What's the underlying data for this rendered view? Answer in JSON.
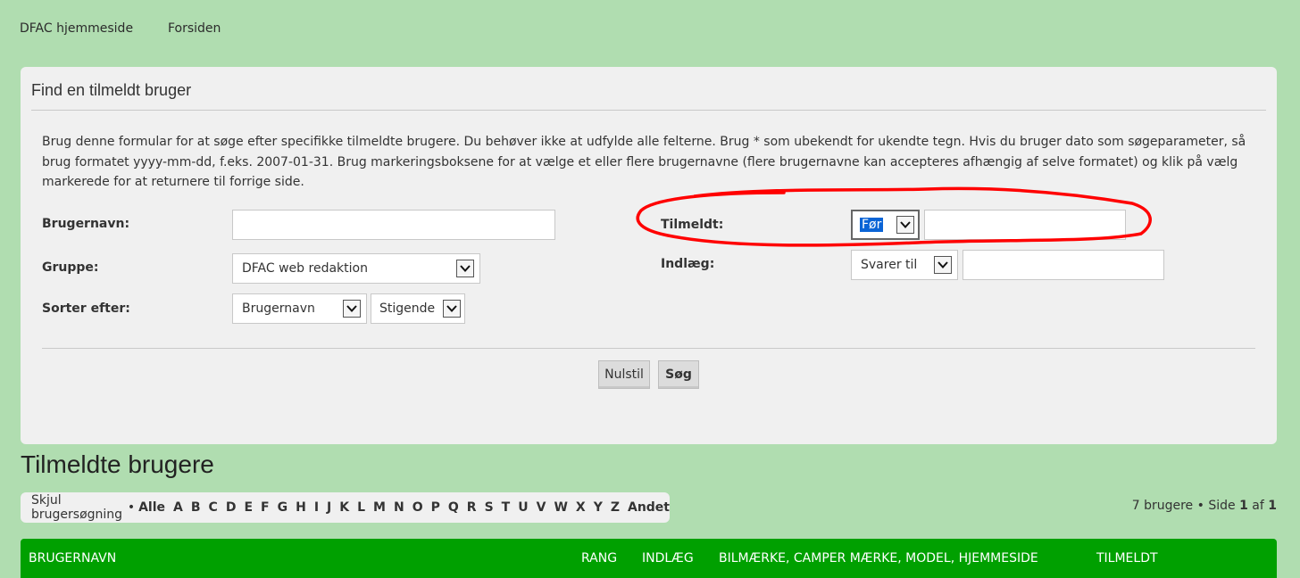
{
  "breadcrumb": {
    "home": "DFAC hjemmeside",
    "forum": "Forsiden"
  },
  "search_panel": {
    "title": "Find en tilmeldt bruger",
    "intro": "Brug denne formular for at søge efter specifikke tilmeldte brugere. Du behøver ikke at udfylde alle felterne. Brug * som ubekendt for ukendte tegn. Hvis du bruger dato som søgeparameter, så brug formatet yyyy-mm-dd, f.eks. 2007-01-31. Brug markeringsboksene for at vælge et eller flere brugernavne (flere brugernavne kan accepteres afhængig af selve formatet) og klik på vælg markerede for at returnere til forrige side.",
    "username_label": "Brugernavn:",
    "username_value": "",
    "group_label": "Gruppe:",
    "group_value": "DFAC web redaktion",
    "sort_label": "Sorter efter:",
    "sort_field_value": "Brugernavn",
    "sort_order_value": "Stigende",
    "joined_label": "Tilmeldt:",
    "joined_mode_value": "Før",
    "joined_date_value": "",
    "posts_label": "Indlæg:",
    "posts_mode_value": "Svarer til",
    "posts_value": "",
    "reset_label": "Nulstil",
    "search_label": "Søg"
  },
  "page_heading": "Tilmeldte brugere",
  "alpha_bar": {
    "hide_label": "Skjul brugersøgning",
    "bullet": "•",
    "letters": [
      "Alle",
      "A",
      "B",
      "C",
      "D",
      "E",
      "F",
      "G",
      "H",
      "I",
      "J",
      "K",
      "L",
      "M",
      "N",
      "O",
      "P",
      "Q",
      "R",
      "S",
      "T",
      "U",
      "V",
      "W",
      "X",
      "Y",
      "Z",
      "Andet"
    ]
  },
  "pagination": {
    "count_text": "7 brugere",
    "bullet": "•",
    "page_word": "Side",
    "current": "1",
    "of_word": "af",
    "total": "1"
  },
  "table": {
    "columns": [
      "BRUGERNAVN",
      "RANG",
      "INDLÆG",
      "BILMÆRKE, CAMPER MÆRKE, MODEL, HJEMMESIDE",
      "TILMELDT"
    ]
  },
  "colors": {
    "page_bg": "#b0ddb0",
    "panel_bg": "#f0f0f0",
    "table_header_bg": "#00a000",
    "annotation_red": "#ff0000",
    "selection_blue": "#0a64d6"
  }
}
